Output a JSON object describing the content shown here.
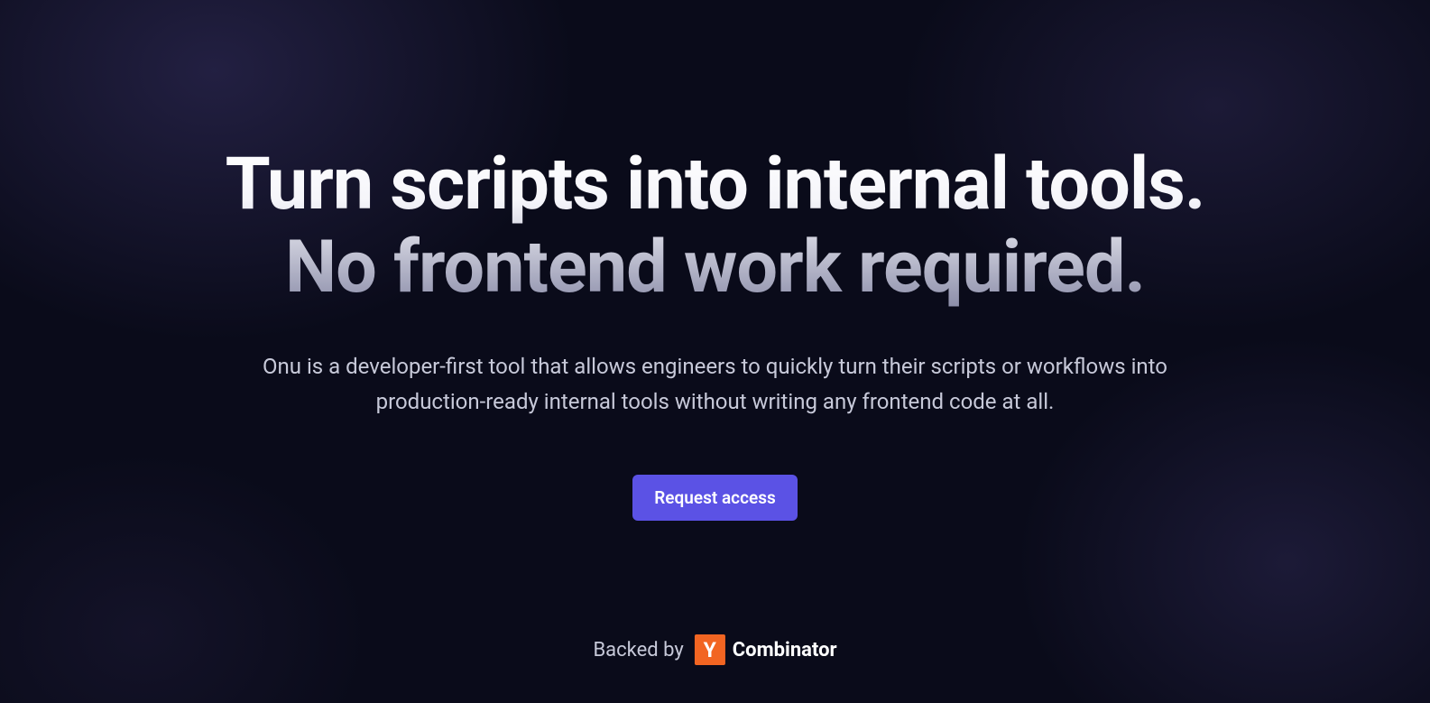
{
  "hero": {
    "headline_line1": "Turn scripts into internal tools.",
    "headline_line2": "No frontend work required.",
    "subtext": "Onu is a developer-first tool that allows engineers to quickly turn their scripts or workflows into production-ready internal tools without writing any frontend code at all.",
    "cta_label": "Request access"
  },
  "footer": {
    "backed_by_label": "Backed by",
    "yc_letter": "Y",
    "yc_name": "Combinator"
  }
}
